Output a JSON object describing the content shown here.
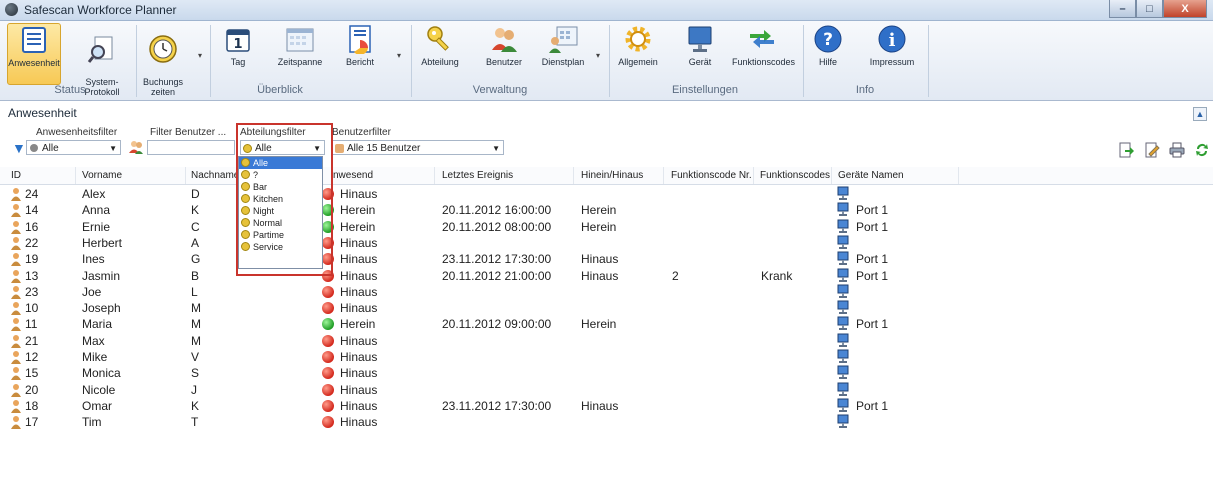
{
  "window": {
    "title": "Safescan Workforce Planner",
    "min": "–",
    "max": "□",
    "close": "X"
  },
  "ribbon": {
    "buttons": {
      "anwesenheit": "Anwesenheit",
      "systemprotokoll": "System-\nProtokoll",
      "buchungszeiten": "Buchungs\nzeiten",
      "tag": "Tag",
      "zeitspanne": "Zeitspanne",
      "bericht": "Bericht",
      "abteilung": "Abteilung",
      "benutzer": "Benutzer",
      "dienstplan": "Dienstplan",
      "allgemein": "Allgemein",
      "geraet": "Gerät",
      "funktionscodes": "Funktionscodes",
      "hilfe": "Hilfe",
      "impressum": "Impressum"
    },
    "groups": {
      "status": "Status",
      "ueberblick": "Überblick",
      "verwaltung": "Verwaltung",
      "einstellungen": "Einstellungen",
      "info": "Info"
    }
  },
  "panel": {
    "title": "Anwesenheit",
    "labels": {
      "anwesenheitsfilter": "Anwesenheitsfilter",
      "filter_benutzer": "Filter Benutzer ...",
      "abteilungsfilter": "Abteilungsfilter",
      "benutzerfilter": "Benutzerfilter"
    },
    "anwesenheit_value": "Alle",
    "abteilung_value": "Alle",
    "benutzer_value": "Alle 15 Benutzer",
    "filter_text": "",
    "dept_options": [
      "Alle",
      "?",
      "Bar",
      "Kitchen",
      "Night",
      "Normal",
      "Partime",
      "Service"
    ]
  },
  "grid": {
    "headers": {
      "id": "ID",
      "vorname": "Vorname",
      "nachname": "Nachname",
      "anwesend": "nwesend",
      "letztes": "Letztes Ereignis",
      "hinein": "Hinein/Hinaus",
      "fcnr": "Funktionscode Nr.",
      "fc": "Funktionscodes",
      "geraete": "Geräte Namen"
    },
    "rows": [
      {
        "id": "24",
        "vorname": "Alex",
        "nachname": "D",
        "status": "Hinaus",
        "in": false,
        "letztes": "",
        "hinein": "",
        "fcnr": "",
        "fc": "",
        "geraet": ""
      },
      {
        "id": "14",
        "vorname": "Anna",
        "nachname": "K",
        "status": "Herein",
        "in": true,
        "letztes": "20.11.2012 16:00:00",
        "hinein": "Herein",
        "fcnr": "",
        "fc": "",
        "geraet": "Port 1"
      },
      {
        "id": "16",
        "vorname": "Ernie",
        "nachname": "C",
        "status": "Herein",
        "in": true,
        "letztes": "20.11.2012 08:00:00",
        "hinein": "Herein",
        "fcnr": "",
        "fc": "",
        "geraet": "Port 1"
      },
      {
        "id": "22",
        "vorname": "Herbert",
        "nachname": "A",
        "status": "Hinaus",
        "in": false,
        "letztes": "",
        "hinein": "",
        "fcnr": "",
        "fc": "",
        "geraet": ""
      },
      {
        "id": "19",
        "vorname": "Ines",
        "nachname": "G",
        "status": "Hinaus",
        "in": false,
        "letztes": "23.11.2012 17:30:00",
        "hinein": "Hinaus",
        "fcnr": "",
        "fc": "",
        "geraet": "Port 1"
      },
      {
        "id": "13",
        "vorname": "Jasmin",
        "nachname": "B",
        "status": "Hinaus",
        "in": false,
        "letztes": "20.11.2012 21:00:00",
        "hinein": "Hinaus",
        "fcnr": "2",
        "fc": "Krank",
        "geraet": "Port 1"
      },
      {
        "id": "23",
        "vorname": "Joe",
        "nachname": "L",
        "status": "Hinaus",
        "in": false,
        "letztes": "",
        "hinein": "",
        "fcnr": "",
        "fc": "",
        "geraet": ""
      },
      {
        "id": "10",
        "vorname": "Joseph",
        "nachname": "M",
        "status": "Hinaus",
        "in": false,
        "letztes": "",
        "hinein": "",
        "fcnr": "",
        "fc": "",
        "geraet": ""
      },
      {
        "id": "11",
        "vorname": "Maria",
        "nachname": "M",
        "status": "Herein",
        "in": true,
        "letztes": "20.11.2012 09:00:00",
        "hinein": "Herein",
        "fcnr": "",
        "fc": "",
        "geraet": "Port 1"
      },
      {
        "id": "21",
        "vorname": "Max",
        "nachname": "M",
        "status": "Hinaus",
        "in": false,
        "letztes": "",
        "hinein": "",
        "fcnr": "",
        "fc": "",
        "geraet": ""
      },
      {
        "id": "12",
        "vorname": "Mike",
        "nachname": "V",
        "status": "Hinaus",
        "in": false,
        "letztes": "",
        "hinein": "",
        "fcnr": "",
        "fc": "",
        "geraet": ""
      },
      {
        "id": "15",
        "vorname": "Monica",
        "nachname": "S",
        "status": "Hinaus",
        "in": false,
        "letztes": "",
        "hinein": "",
        "fcnr": "",
        "fc": "",
        "geraet": ""
      },
      {
        "id": "20",
        "vorname": "Nicole",
        "nachname": "J",
        "status": "Hinaus",
        "in": false,
        "letztes": "",
        "hinein": "",
        "fcnr": "",
        "fc": "",
        "geraet": ""
      },
      {
        "id": "18",
        "vorname": "Omar",
        "nachname": "K",
        "status": "Hinaus",
        "in": false,
        "letztes": "23.11.2012 17:30:00",
        "hinein": "Hinaus",
        "fcnr": "",
        "fc": "",
        "geraet": "Port 1"
      },
      {
        "id": "17",
        "vorname": "Tim",
        "nachname": "T",
        "status": "Hinaus",
        "in": false,
        "letztes": "",
        "hinein": "",
        "fcnr": "",
        "fc": "",
        "geraet": ""
      }
    ]
  },
  "colors": {
    "in": "#1f9d25",
    "out": "#d3281c",
    "highlight": "#c9342c",
    "selection": "#3a7ad6"
  }
}
